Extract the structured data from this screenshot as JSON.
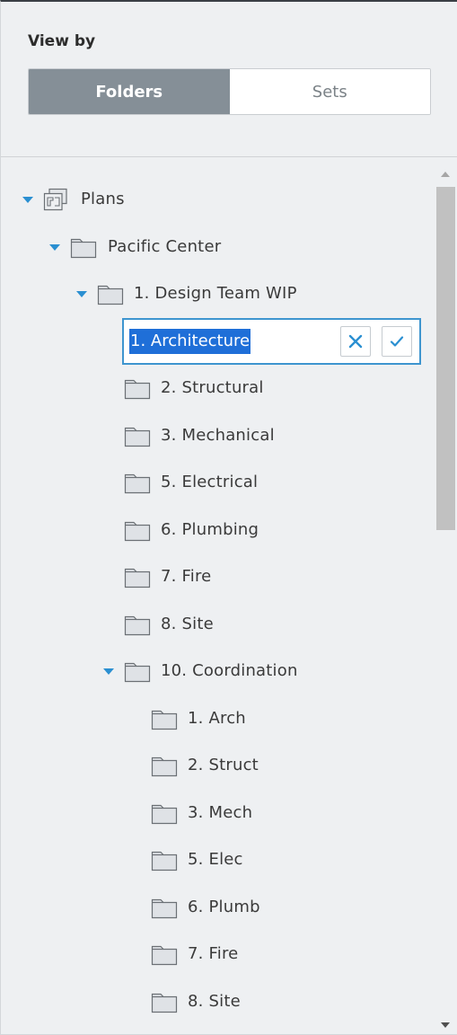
{
  "view_by": {
    "label": "View by",
    "options": [
      "Folders",
      "Sets"
    ],
    "selected": "Folders"
  },
  "tree": {
    "root": "Plans",
    "project": "Pacific Center",
    "wip": "1. Design Team WIP",
    "editing": {
      "value": "1. Architecture"
    },
    "wip_children": [
      "2. Structural",
      "3. Mechanical",
      "5. Electrical",
      "6. Plumbing",
      "7. Fire",
      "8. Site"
    ],
    "coordination": "10. Coordination",
    "coordination_children": [
      "1. Arch",
      "2. Struct",
      "3. Mech",
      "5. Elec",
      "6. Plumb",
      "7. Fire",
      "8. Site"
    ]
  },
  "colors": {
    "accent": "#2a8fd1",
    "segment_active": "#858f97",
    "selection": "#1f6fd8",
    "folder_fill": "#dfe2e6",
    "folder_stroke": "#6b7075"
  },
  "icons": {
    "root": "plans-icon",
    "folder": "folder-icon",
    "expand": "caret-down-icon",
    "cancel": "close-icon",
    "confirm": "check-icon"
  }
}
